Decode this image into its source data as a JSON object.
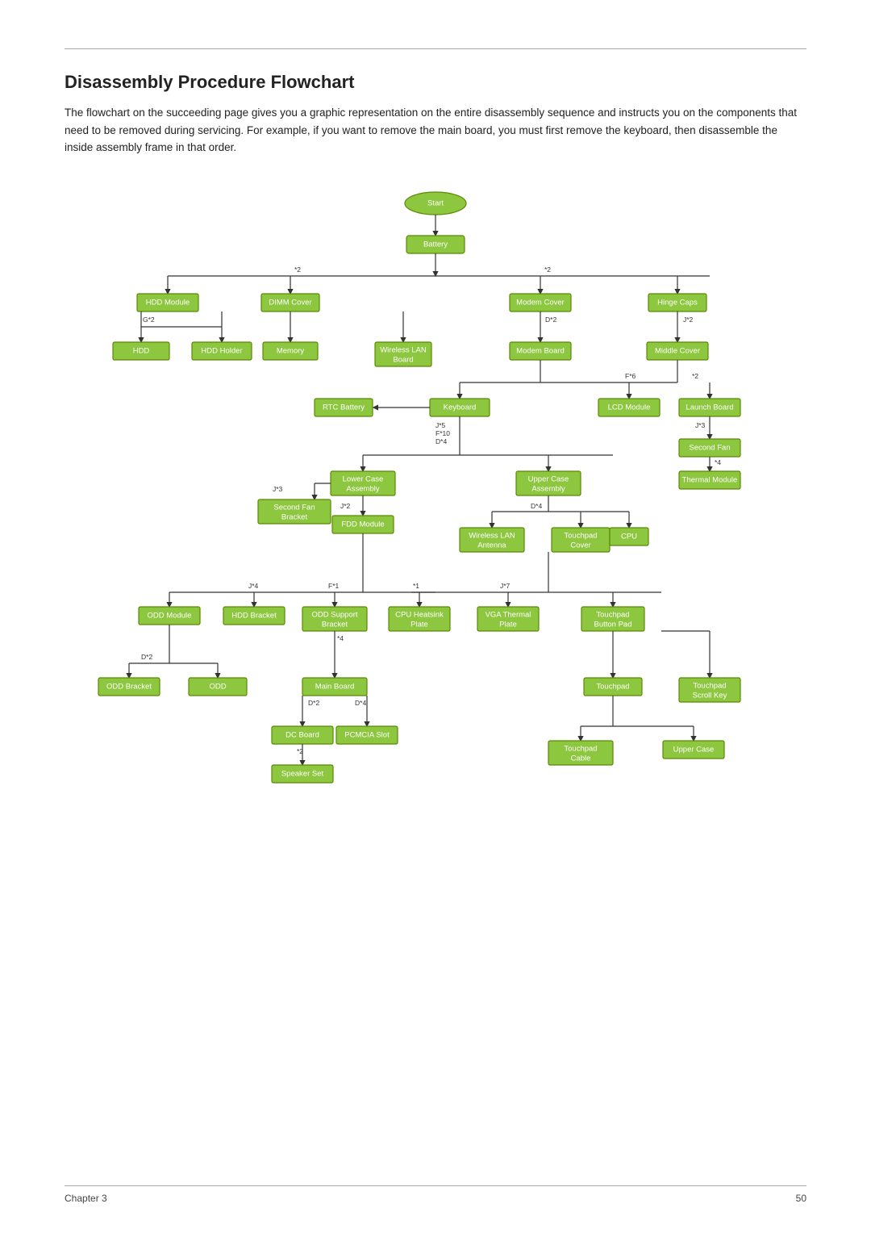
{
  "page": {
    "title": "Disassembly Procedure Flowchart",
    "intro": "The flowchart on the succeeding page gives you a graphic representation on the entire disassembly sequence and instructs you on the components that need to be removed during servicing. For example, if you want to remove the main board, you must first remove the keyboard, then disassemble the inside assembly frame in that order.",
    "footer_left": "Chapter 3",
    "footer_right": "50"
  },
  "nodes": {
    "start": "Start",
    "battery": "Battery",
    "hdd_module": "HDD Module",
    "dimm_cover": "DIMM Cover",
    "modem_cover": "Modem Cover",
    "hinge_caps": "Hinge Caps",
    "hdd": "HDD",
    "hdd_holder": "HDD Holder",
    "memory": "Memory",
    "wireless_lan_board": "Wireless LAN Board",
    "modem_board": "Modem Board",
    "middle_cover": "Middle Cover",
    "rtc_battery": "RTC Battery",
    "keyboard": "Keyboard",
    "lcd_module": "LCD Module",
    "launch_board": "Launch Board",
    "second_fan": "Second Fan",
    "thermal_module": "Thermal Module",
    "lower_case": "Lower Case Assembly",
    "upper_case_asm": "Upper Case Assembly",
    "second_fan_bracket": "Second Fan Bracket",
    "fdd_module": "FDD Module",
    "wireless_ant": "Wireless LAN Antenna",
    "touchpad_cover": "Touchpad Cover",
    "cpu": "CPU",
    "odd_module": "ODD Module",
    "hdd_bracket": "HDD Bracket",
    "odd_support_bracket": "ODD Support Bracket",
    "cpu_heatsink_plate": "CPU Heatsink Plate",
    "vga_thermal_plate": "VGA Thermal Plate",
    "touchpad_button_pad": "Touchpad Button Pad",
    "odd_bracket": "ODD Bracket",
    "odd": "ODD",
    "main_board": "Main Board",
    "touchpad": "Touchpad",
    "touchpad_scroll_key": "Touchpad Scroll Key",
    "dc_board": "DC Board",
    "pcmcia_slot": "PCMCIA Slot",
    "touchpad_cable": "Touchpad Cable",
    "upper_case": "Upper Case",
    "speaker_set": "Speaker Set"
  }
}
